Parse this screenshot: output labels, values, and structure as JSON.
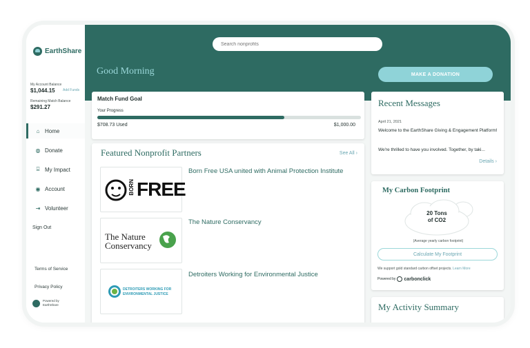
{
  "brand": {
    "name": "EarthShare"
  },
  "sidebar": {
    "account_balance_label": "My Account Balance",
    "account_balance_value": "$1,044.15",
    "add_funds_label": "Add Funds",
    "match_balance_label": "Remaining Match Balance",
    "match_balance_value": "$291.27",
    "nav": [
      {
        "label": "Home",
        "icon": "home-icon",
        "active": true
      },
      {
        "label": "Donate",
        "icon": "donate-icon"
      },
      {
        "label": "My Impact",
        "icon": "bank-icon"
      },
      {
        "label": "Account",
        "icon": "account-icon"
      },
      {
        "label": "Volunteer",
        "icon": "volunteer-icon"
      }
    ],
    "sign_out": "Sign Out",
    "terms": "Terms of Service",
    "privacy": "Privacy Policy",
    "powered_line1": "Powered by",
    "powered_line2": "EarthShare"
  },
  "header": {
    "search_placeholder": "Search nonprofits",
    "greeting": "Good Morning",
    "donate_button": "MAKE A DONATION"
  },
  "match_fund": {
    "title": "Match Fund Goal",
    "progress_label": "Your Progress",
    "used": "$708.73 Used",
    "goal": "$1,000.00",
    "progress_fraction": 0.7087
  },
  "featured": {
    "title": "Featured Nonprofit Partners",
    "see_all": "See All",
    "items": [
      {
        "name": "Born Free USA united with Animal Protection Institute",
        "logo_text": "FREE",
        "logo_side": "BORN"
      },
      {
        "name": "The Nature Conservancy",
        "logo_line1": "The Nature",
        "logo_line2": "Conservancy"
      },
      {
        "name": "Detroiters Working for Environmental Justice",
        "logo_line1": "DETROITERS WORKING FOR",
        "logo_line2": "ENVIRONMENTAL JUSTICE"
      }
    ]
  },
  "messages": {
    "title": "Recent Messages",
    "date": "April 21, 2021",
    "headline": "Welcome to the EarthShare Giving & Engagement Platform!",
    "preview": "We're thrilled to have you involved. Together, by taki...",
    "details": "Details"
  },
  "carbon": {
    "title": "My Carbon Footprint",
    "value_line1": "20 Tons",
    "value_line2": "of CO2",
    "average_note": "(Average yearly carbon footprint)",
    "button": "Calculate My Footprint",
    "gold_note": "We support gold standard carbon offset projects.",
    "learn_more": "Learn More",
    "powered_by": "Powered by",
    "partner": "carbonclick"
  },
  "activity": {
    "title": "My Activity Summary"
  },
  "colors": {
    "primary": "#2e6b62",
    "accent": "#8fd3d8",
    "link": "#6aa7b2"
  }
}
